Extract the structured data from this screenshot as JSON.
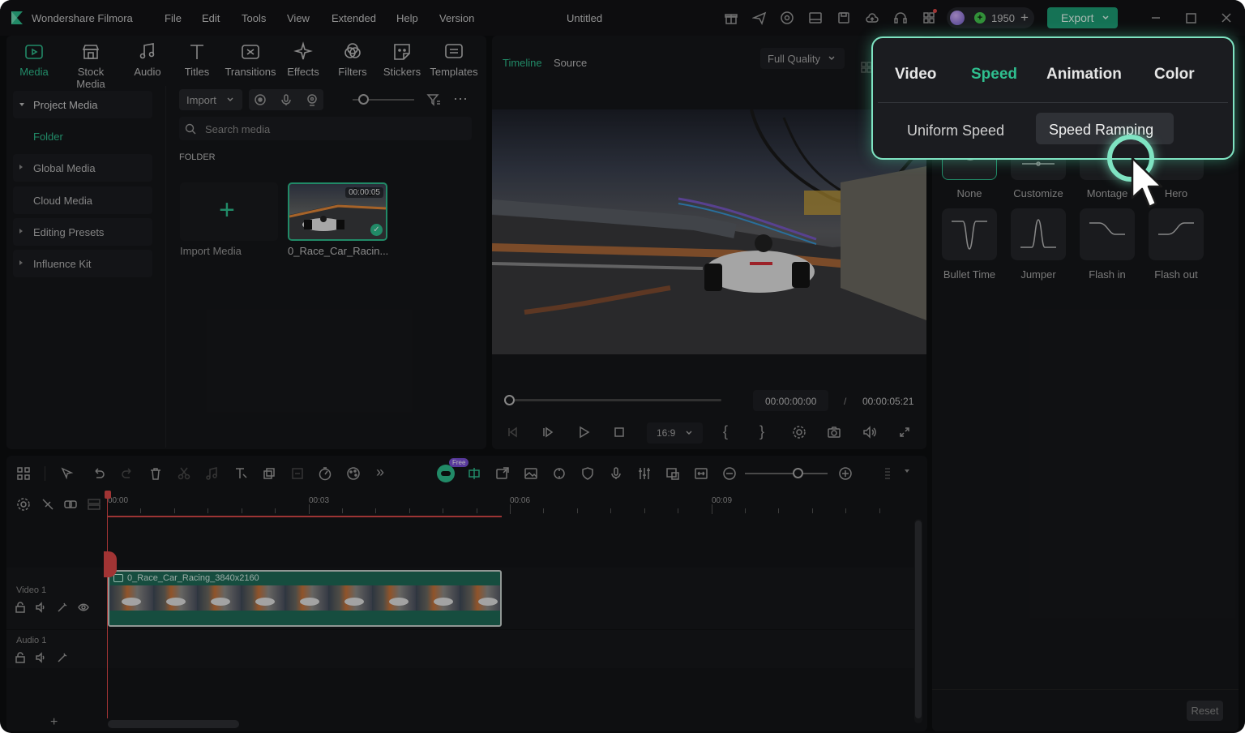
{
  "app": {
    "name": "Wondershare Filmora",
    "menu": [
      "File",
      "Edit",
      "Tools",
      "View",
      "Extended",
      "Help",
      "Version"
    ],
    "title": "Untitled",
    "credits": "1950",
    "export_label": "Export"
  },
  "media_tabs": [
    "Media",
    "Stock Media",
    "Audio",
    "Titles",
    "Transitions",
    "Effects",
    "Filters",
    "Stickers",
    "Templates"
  ],
  "sidebar": {
    "items": [
      {
        "label": "Project Media",
        "expanded": true
      },
      {
        "label": "Folder"
      },
      {
        "label": "Global Media"
      },
      {
        "label": "Cloud Media"
      },
      {
        "label": "Editing Presets"
      },
      {
        "label": "Influence Kit"
      }
    ]
  },
  "media": {
    "import_label": "Import",
    "search_placeholder": "Search media",
    "section_label": "FOLDER",
    "import_media_label": "Import Media",
    "clip_name": "0_Race_Car_Racin...",
    "clip_duration": "00:00:05"
  },
  "player": {
    "tabs": [
      "Timeline",
      "Source"
    ],
    "quality": "Full Quality",
    "current_time": "00:00:00:00",
    "separator": "/",
    "total_time": "00:00:05:21",
    "aspect": "16:9",
    "progress": 0.0
  },
  "speed_panel": {
    "presets": [
      "None",
      "Customize",
      "Montage",
      "Hero",
      "Bullet Time",
      "Jumper",
      "Flash in",
      "Flash out"
    ],
    "reset_label": "Reset"
  },
  "callout": {
    "tabs": [
      "Video",
      "Speed",
      "Animation",
      "Color"
    ],
    "active_tab": "Speed",
    "subtabs": [
      "Uniform Speed",
      "Speed Ramping"
    ],
    "active_subtab": "Speed Ramping"
  },
  "timeline": {
    "free_badge": "Free",
    "ruler_labels": [
      "00:00",
      "00:03",
      "00:06",
      "00:09"
    ],
    "tracks": [
      {
        "label": "Video 1"
      },
      {
        "label": "Audio 1"
      }
    ],
    "clip_label": "0_Race_Car_Racing_3840x2160",
    "add_track_label": "+"
  },
  "colors": {
    "accent": "#2fbf8f",
    "export_bg": "#1e9e76",
    "callout_border": "#7fe3c2",
    "playhead": "#e04848"
  }
}
